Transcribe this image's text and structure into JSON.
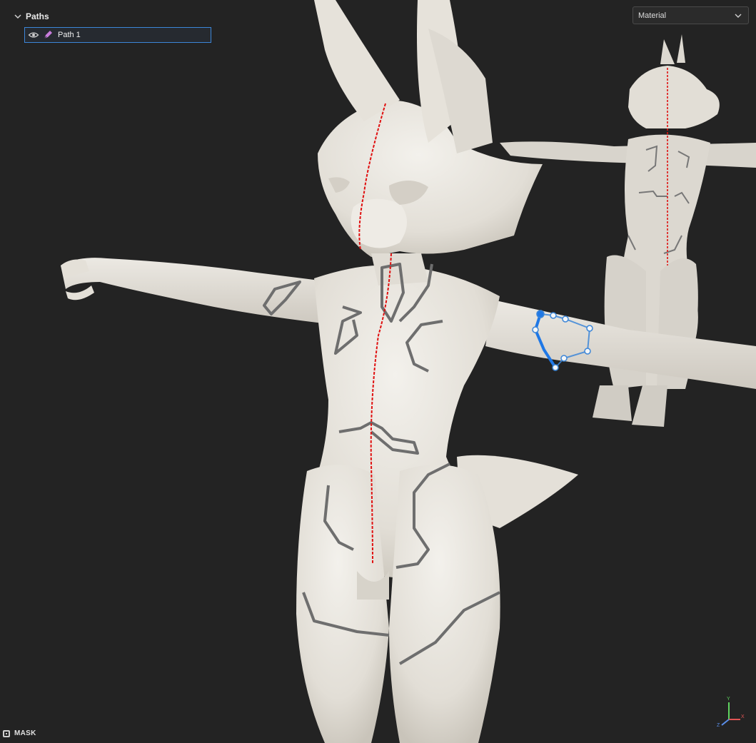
{
  "paths_panel": {
    "title": "Paths",
    "items": [
      {
        "label": "Path 1",
        "visible": true,
        "selected": true
      }
    ]
  },
  "material_dropdown": {
    "selected": "Material"
  },
  "mask_toggle": {
    "label": "MASK"
  },
  "axis_gizmo": {
    "x_label": "X",
    "y_label": "Y",
    "z_label": "Z"
  },
  "colors": {
    "background": "#232323",
    "model": "#e9e6e0",
    "symmetry_line": "#e01010",
    "path_accent": "#3c86d8",
    "selection_border": "#3c86d8"
  }
}
